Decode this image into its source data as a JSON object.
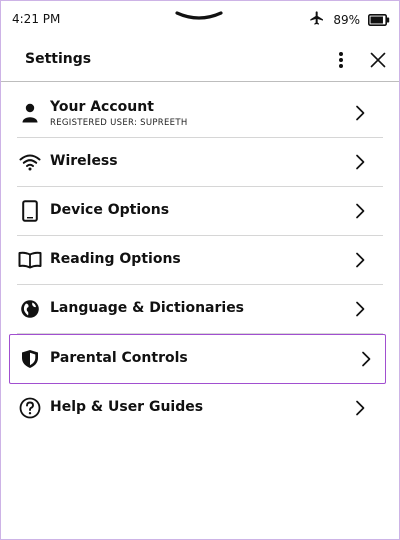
{
  "status_bar": {
    "time": "4:21 PM",
    "battery_percent": "89%",
    "battery_level": 0.89,
    "icons": [
      "airplane-mode-icon",
      "battery-icon"
    ]
  },
  "header": {
    "title": "Settings",
    "menu_icon": "more-vertical-icon",
    "close_icon": "close-icon"
  },
  "settings": {
    "items": [
      {
        "label": "Your Account",
        "subtitle": "REGISTERED USER: SUPREETH",
        "icon": "person-icon"
      },
      {
        "label": "Wireless",
        "icon": "wifi-icon"
      },
      {
        "label": "Device Options",
        "icon": "device-icon"
      },
      {
        "label": "Reading Options",
        "icon": "book-icon"
      },
      {
        "label": "Language & Dictionaries",
        "icon": "globe-icon"
      },
      {
        "label": "Parental Controls",
        "icon": "shield-icon",
        "highlighted": true
      },
      {
        "label": "Help & User Guides",
        "icon": "help-icon"
      }
    ]
  },
  "colors": {
    "highlight_border": "#a14fd0",
    "frame_border": "#cdb3e6",
    "divider": "#d6d6d6"
  }
}
